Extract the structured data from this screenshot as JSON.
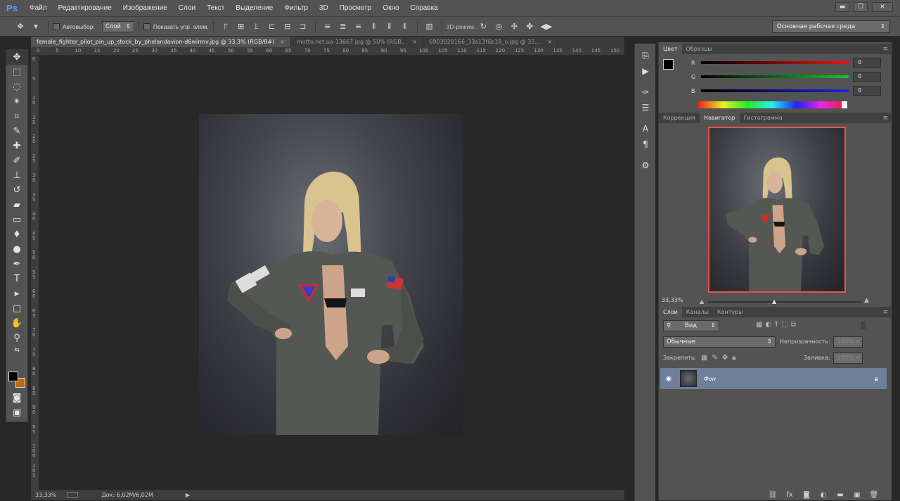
{
  "app": {
    "logo": "Ps"
  },
  "menu": [
    "Файл",
    "Редактирование",
    "Изображение",
    "Слои",
    "Текст",
    "Выделение",
    "Фильтр",
    "3D",
    "Просмотр",
    "Окно",
    "Справка"
  ],
  "window_controls": {
    "minimize": "▬",
    "restore": "❐",
    "close": "✕"
  },
  "options": {
    "autoselect_label": "Автовыбор:",
    "autoselect_value": "Слой",
    "show_transform_label": "Показать упр. элем.",
    "mode_3d_label": "3D-режим:",
    "workspace": "Основная рабочая среда"
  },
  "tabs": [
    {
      "label": "female_fighter_pilot_pin_up_stock_by_phelandavion-d6wirmv.jpg @ 33,3% (RGB/8#)",
      "close": "×"
    },
    {
      "label": "motto.net.ua-13667.jpg @ 50% (RGB...",
      "close": "×"
    },
    {
      "label": "6903928166_33a13f6b18_o.jpg @ 33,...",
      "close": "×"
    }
  ],
  "ruler_top": [
    "0",
    "5",
    "10",
    "15",
    "20",
    "25",
    "30",
    "35",
    "40",
    "45",
    "50",
    "55",
    "60",
    "65",
    "70",
    "75",
    "80",
    "85",
    "90",
    "95",
    "100",
    "105",
    "110",
    "115",
    "120",
    "125",
    "130",
    "135",
    "140",
    "145",
    "150"
  ],
  "ruler_left": [
    "0",
    "5",
    "1\n0",
    "1\n5",
    "2\n0",
    "2\n5",
    "3\n0",
    "3\n5",
    "4\n0",
    "4\n5",
    "5\n0",
    "5\n5",
    "6\n0",
    "6\n5",
    "7\n0",
    "7\n5",
    "8\n0",
    "8\n5",
    "9\n0",
    "9\n5",
    "1\n0\n0",
    "1\n0\n5"
  ],
  "status": {
    "zoom": "33,33%",
    "doc": "Док: 6,02M/6,02M"
  },
  "color_panel": {
    "tabs": [
      "Цвет",
      "Образцы"
    ],
    "channels": [
      {
        "label": "R",
        "value": "0"
      },
      {
        "label": "G",
        "value": "0"
      },
      {
        "label": "B",
        "value": "0"
      }
    ],
    "fg": "#000000",
    "bg": "#c06a10"
  },
  "navigator_panel": {
    "tabs": [
      "Коррекция",
      "Навигатор",
      "Гистограмма"
    ],
    "zoom": "33,33%"
  },
  "layers_panel": {
    "tabs": [
      "Слои",
      "Каналы",
      "Контуры"
    ],
    "filter": "Вид",
    "blend_mode": "Обычные",
    "opacity_label": "Непрозрачность:",
    "opacity_value": "100%",
    "lock_label": "Закрепить:",
    "fill_label": "Заливка:",
    "fill_value": "100%",
    "layers": [
      {
        "name": "Фон"
      }
    ]
  },
  "tools": [
    "move",
    "marquee",
    "lasso",
    "quick-select",
    "crop",
    "eyedropper",
    "healing",
    "brush",
    "stamp",
    "history-brush",
    "eraser",
    "gradient",
    "blur",
    "dodge",
    "pen",
    "type",
    "path-select",
    "shape",
    "hand",
    "zoom"
  ]
}
